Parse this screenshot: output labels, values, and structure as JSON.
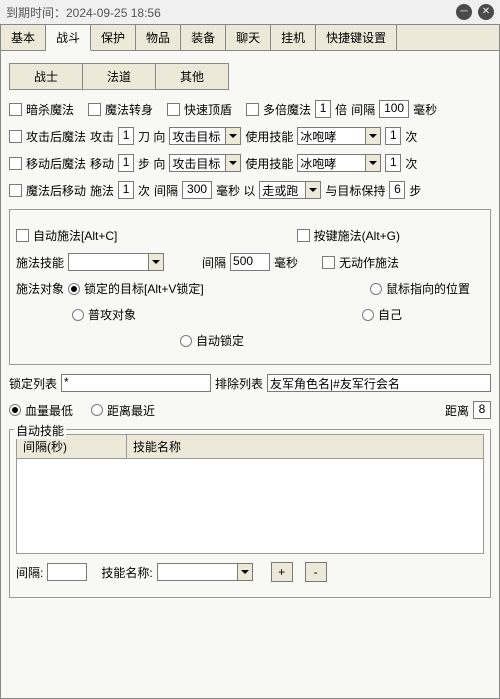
{
  "titlebar": {
    "text": "到期时间：2024-09-25 18:56"
  },
  "tabs1": [
    "基本",
    "战斗",
    "保护",
    "物品",
    "装备",
    "聊天",
    "挂机",
    "快捷键设置"
  ],
  "tabs1_active": 1,
  "tabs2": [
    "战士",
    "法道",
    "其他"
  ],
  "tabs2_active": 1,
  "r1": {
    "c1": "暗杀魔法",
    "c2": "魔法转身",
    "c3": "快速顶盾",
    "c4": "多倍魔法",
    "mult": "1",
    "l_bei": "倍",
    "l_jiange": "间隔",
    "intv": "100",
    "l_ms": "毫秒"
  },
  "r2": {
    "c": "攻击后魔法",
    "l1": "攻击",
    "v1": "1",
    "l2": "刀 向",
    "sel1": "攻击目标",
    "l3": "使用技能",
    "sel2": "冰咆哮",
    "v2": "1",
    "l4": "次"
  },
  "r3": {
    "c": "移动后魔法",
    "l1": "移动",
    "v1": "1",
    "l2": "步 向",
    "sel1": "攻击目标",
    "l3": "使用技能",
    "sel2": "冰咆哮",
    "v2": "1",
    "l4": "次"
  },
  "r4": {
    "c": "魔法后移动",
    "l1": "施法",
    "v1": "1",
    "l2": "次",
    "l3": "间隔",
    "v2": "300",
    "l4": "毫秒 以",
    "sel": "走或跑",
    "l5": "与目标保持",
    "v3": "6",
    "l6": "步"
  },
  "box1": {
    "c1": "自动施法[Alt+C]",
    "c2": "按键施法(Alt+G)",
    "l1": "施法技能",
    "l2": "间隔",
    "intv": "500",
    "l3": "毫秒",
    "c3": "无动作施法",
    "l4": "施法对象",
    "r1": "锁定的目标[Alt+V锁定]",
    "r2": "鼠标指向的位置",
    "r3": "普攻对象",
    "r4": "自己",
    "r5": "自动锁定"
  },
  "box2": {
    "l1": "锁定列表",
    "v1": "*",
    "l2": "排除列表",
    "v2": "友军角色名|#友军行会名",
    "r1": "血量最低",
    "r2": "距离最近",
    "l3": "距离",
    "v3": "8"
  },
  "auto": {
    "legend": "自动技能",
    "col1": "间隔(秒)",
    "col2": "技能名称",
    "l1": "间隔:",
    "l2": "技能名称:",
    "btn1": "+",
    "btn2": "-"
  }
}
